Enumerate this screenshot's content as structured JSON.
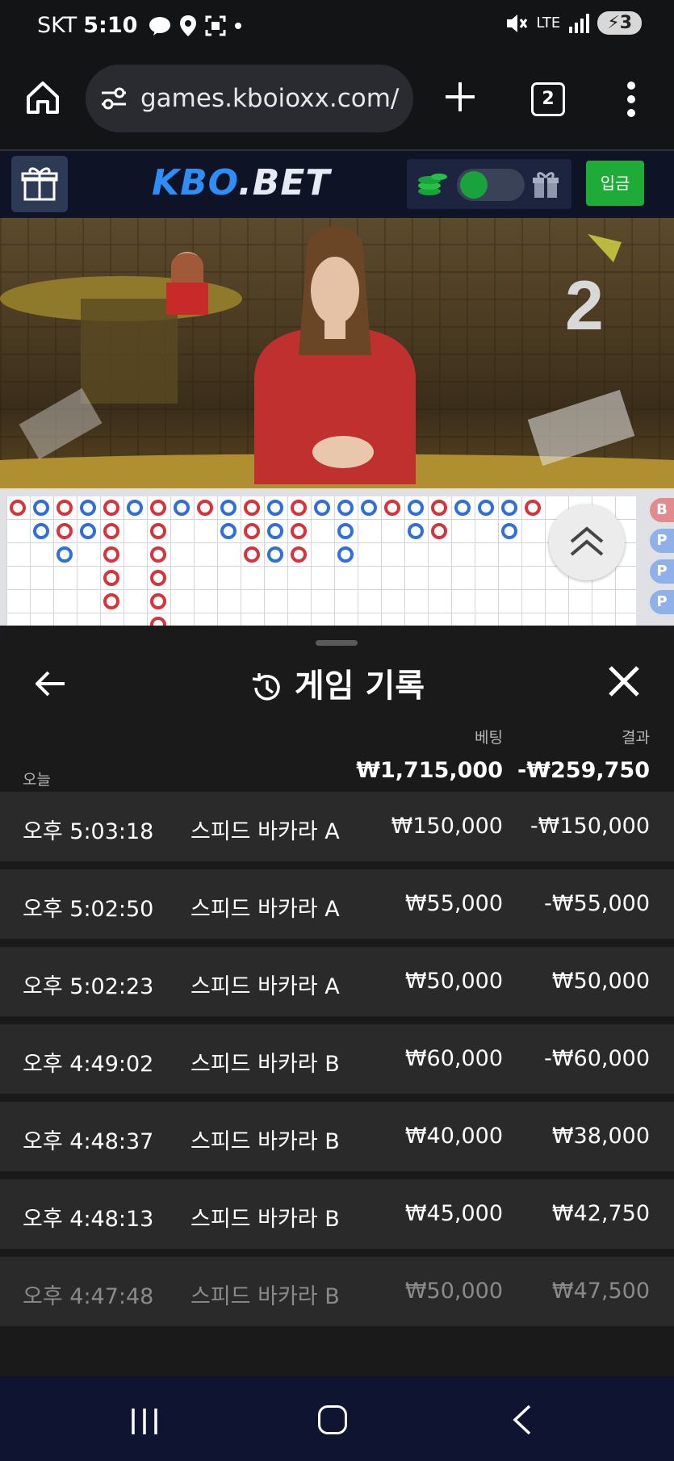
{
  "status_bar": {
    "carrier": "SKT",
    "time": "5:10",
    "network": "LTE",
    "battery": "3"
  },
  "browser": {
    "url": "games.kboioxx.com/",
    "tab_count": "2"
  },
  "site": {
    "logo_part1": "KBO",
    "logo_dot": ".",
    "logo_part2": "BET",
    "deposit_label": "입금",
    "accent_color": "#2e8ef5",
    "deposit_color": "#1eab38"
  },
  "video": {
    "countdown": "2"
  },
  "roadmap": {
    "side_tags": [
      "B",
      "P",
      "P",
      "P"
    ],
    "banker_color": "#d6333a",
    "player_color": "#2f6fd8"
  },
  "history": {
    "title": "게임 기록",
    "bet_label": "베팅",
    "result_label": "결과",
    "today_label": "오늘",
    "total_bet": "₩1,715,000",
    "total_result": "-₩259,750",
    "rows": [
      {
        "time": "오후 5:03:18",
        "game": "스피드 바카라 A",
        "bet": "₩150,000",
        "result": "-₩150,000"
      },
      {
        "time": "오후 5:02:50",
        "game": "스피드 바카라 A",
        "bet": "₩55,000",
        "result": "-₩55,000"
      },
      {
        "time": "오후 5:02:23",
        "game": "스피드 바카라 A",
        "bet": "₩50,000",
        "result": "₩50,000"
      },
      {
        "time": "오후 4:49:02",
        "game": "스피드 바카라 B",
        "bet": "₩60,000",
        "result": "-₩60,000"
      },
      {
        "time": "오후 4:48:37",
        "game": "스피드 바카라 B",
        "bet": "₩40,000",
        "result": "₩38,000"
      },
      {
        "time": "오후 4:48:13",
        "game": "스피드 바카라 B",
        "bet": "₩45,000",
        "result": "₩42,750"
      },
      {
        "time": "오후 4:47:48",
        "game": "스피드 바카라 B",
        "bet": "₩50,000",
        "result": "₩47,500"
      }
    ]
  }
}
